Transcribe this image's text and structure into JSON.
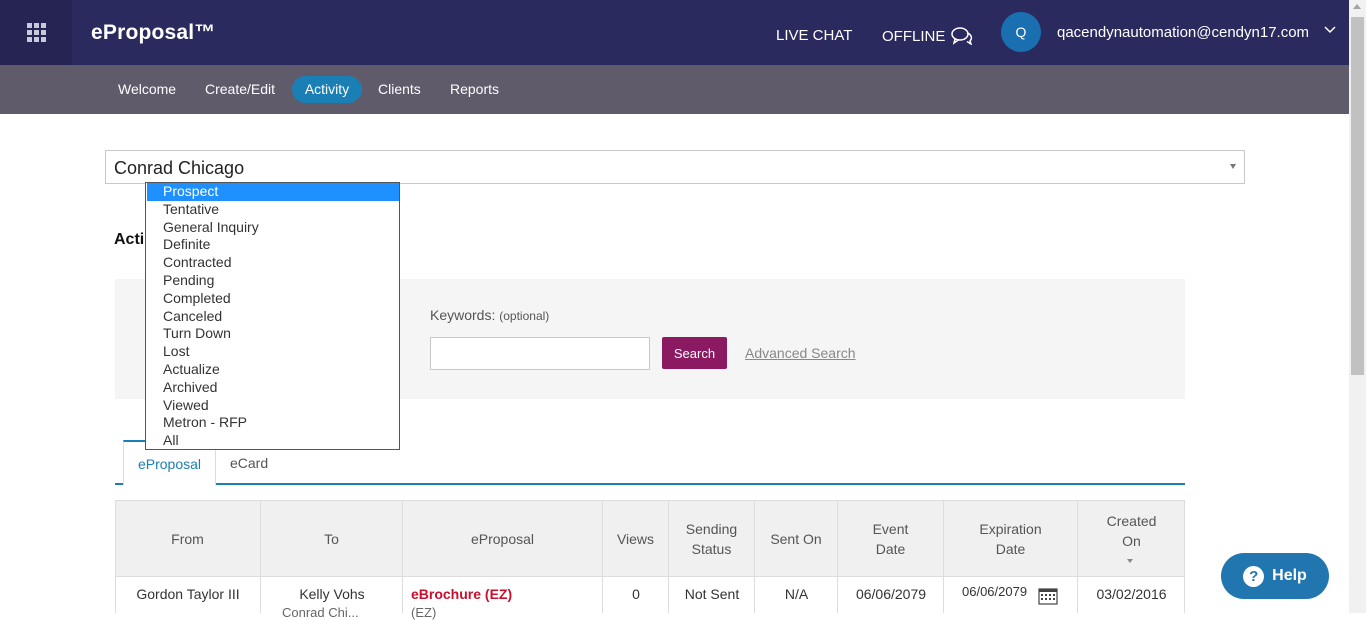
{
  "header": {
    "brand": "eProposal™",
    "live_chat": "LIVE CHAT",
    "offline": "OFFLINE",
    "avatar_initial": "Q",
    "user_email": "qacendynautomation@cendyn17.com"
  },
  "nav": {
    "items": [
      {
        "label": "Welcome",
        "active": false
      },
      {
        "label": "Create/Edit",
        "active": false
      },
      {
        "label": "Activity",
        "active": true
      },
      {
        "label": "Clients",
        "active": false
      },
      {
        "label": "Reports",
        "active": false
      }
    ]
  },
  "hotel_select": {
    "value": "Conrad Chicago"
  },
  "section": {
    "title": "Acti"
  },
  "status_dropdown": {
    "selected": "Prospect",
    "options": [
      "Prospect",
      "Tentative",
      "General Inquiry",
      "Definite",
      "Contracted",
      "Pending",
      "Completed",
      "Canceled",
      "Turn Down",
      "Lost",
      "Actualize",
      "Archived",
      "Viewed",
      "Metron - RFP",
      "All"
    ]
  },
  "search": {
    "keywords_label": "Keywords:",
    "keywords_optional": "(optional)",
    "keywords_value": "",
    "button_label": "Search",
    "advanced_label": "Advanced Search"
  },
  "tabs": [
    {
      "label": "eProposal",
      "active": true
    },
    {
      "label": "eCard",
      "active": false
    }
  ],
  "table": {
    "columns": [
      "From",
      "To",
      "eProposal",
      "Views",
      "Sending Status",
      "Sent On",
      "Event Date",
      "Expiration Date",
      "Created On"
    ],
    "rows": [
      {
        "from": "Gordon Taylor III",
        "to": "Kelly Vohs",
        "to_sub": "Conrad Chi...",
        "eproposal": "eBrochure (EZ)",
        "eproposal_sub": "(EZ)",
        "views": "0",
        "sending_status": "Not Sent",
        "sent_on": "N/A",
        "event_date": "06/06/2079",
        "expiration_date": "06/06/2079",
        "created_on": "03/02/2016"
      }
    ]
  },
  "help": {
    "label": "Help"
  },
  "colors": {
    "topbar": "#2b2a5e",
    "navbar": "#5f5b6b",
    "accent": "#1a7fb4",
    "search_button": "#8c1a62",
    "help_button": "#2276b0",
    "selected_option": "#1e90ff",
    "link_red": "#c8102e"
  }
}
